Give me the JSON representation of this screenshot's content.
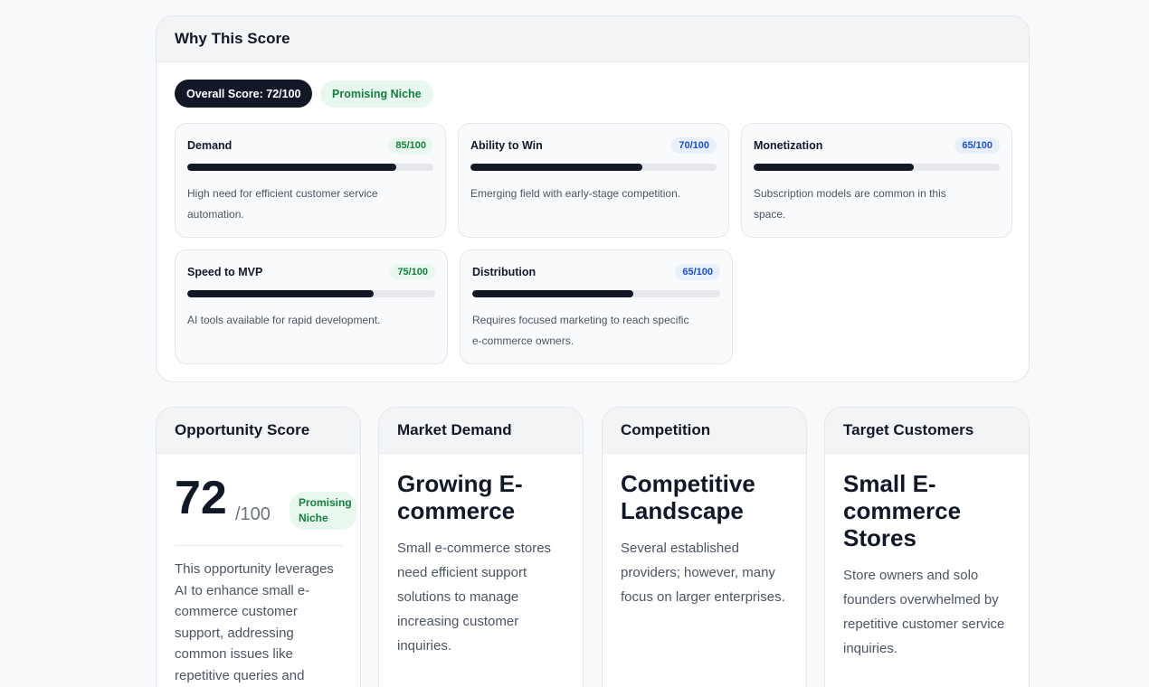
{
  "why": {
    "title": "Why This Score",
    "overall_label": "Overall Score: 72/100",
    "niche_label": "Promising Niche",
    "metrics": [
      {
        "label": "Demand",
        "score": "85/100",
        "value": 85,
        "desc": "High need for efficient customer service automation.",
        "color": "#15803d"
      },
      {
        "label": "Ability to Win",
        "score": "70/100",
        "value": 70,
        "desc": "Emerging field with early-stage competition.",
        "color": "#1d4ed8"
      },
      {
        "label": "Monetization",
        "score": "65/100",
        "value": 65,
        "desc": "Subscription models are common in this space.",
        "color": "#1d4ed8"
      },
      {
        "label": "Speed to MVP",
        "score": "75/100",
        "value": 75,
        "desc": "AI tools available for rapid development.",
        "color": "#15803d"
      },
      {
        "label": "Distribution",
        "score": "65/100",
        "value": 65,
        "desc": "Requires focused marketing to reach specific e-commerce owners.",
        "color": "#1d4ed8"
      }
    ]
  },
  "opportunity": {
    "title": "Opportunity Score",
    "score": "72",
    "out_of": "/100",
    "badge": "Promising Niche",
    "text": "This opportunity leverages AI to enhance small e-commerce customer support, addressing common issues like repetitive queries and manual tracking. Strong"
  },
  "market": {
    "title": "Market Demand",
    "heading": "Growing E-commerce",
    "text": "Small e-commerce stores need efficient support solutions to manage increasing customer inquiries."
  },
  "competition": {
    "title": "Competition",
    "heading": "Competitive Landscape",
    "text": "Several established providers; however, many focus on larger enterprises."
  },
  "customers": {
    "title": "Target Customers",
    "heading": "Small E-commerce Stores",
    "text": "Store owners and solo founders overwhelmed by repetitive customer service inquiries."
  }
}
